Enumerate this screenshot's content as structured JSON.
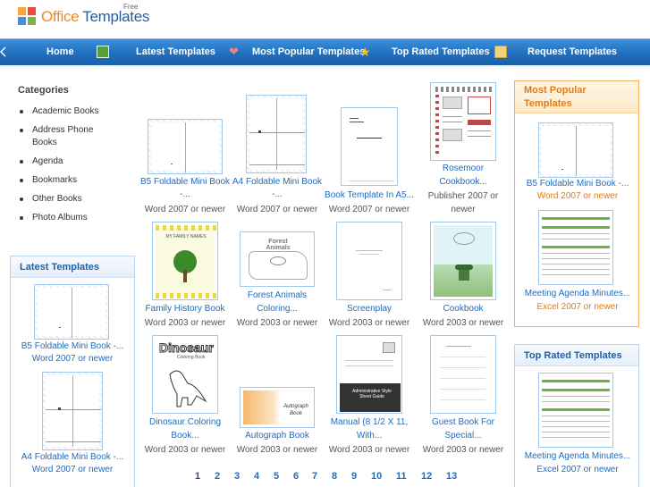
{
  "header": {
    "logo_office": "Office",
    "logo_templates": "Templates",
    "logo_free": "Free"
  },
  "nav": {
    "items": [
      "Home",
      "Latest Templates",
      "Most Popular Templates",
      "Top Rated Templates",
      "Request Templates"
    ]
  },
  "sidebar": {
    "categories_title": "Categories",
    "categories": [
      "Academic Books",
      "Address Phone Books",
      "Agenda",
      "Bookmarks",
      "Other Books",
      "Photo Albums"
    ],
    "latest_title": "Latest Templates",
    "latest": [
      {
        "title": "B5 Foldable Mini Book -...",
        "sub": "Word 2007 or newer"
      },
      {
        "title": "A4 Foldable Mini Book -...",
        "sub": "Word 2007 or newer"
      }
    ]
  },
  "main": {
    "items": [
      {
        "title": "B5 Foldable Mini Book",
        "title2": "-...",
        "sub": "Word 2007 or newer"
      },
      {
        "title": "A4 Foldable Mini Book",
        "title2": "-...",
        "sub": "Word 2007 or newer"
      },
      {
        "title": "Book Template In A5...",
        "title2": "",
        "sub": "Word 2007 or newer"
      },
      {
        "title": "Rosemoor",
        "title2": "Cookbook...",
        "sub": "Publisher 2007 or",
        "sub2": "newer"
      },
      {
        "title": "Family History Book",
        "title2": "",
        "sub": "Word 2003 or newer"
      },
      {
        "title": "Forest Animals",
        "title2": "Coloring...",
        "sub": "Word 2003 or newer"
      },
      {
        "title": "Screenplay",
        "title2": "",
        "sub": "Word 2003 or newer"
      },
      {
        "title": "Cookbook",
        "title2": "",
        "sub": "Word 2003 or newer"
      },
      {
        "title": "Dinosaur Coloring",
        "title2": "Book...",
        "sub": "Word 2003 or newer"
      },
      {
        "title": "Autograph Book",
        "title2": "",
        "sub": "Word 2003 or newer"
      },
      {
        "title": "Manual (8 1/2 X 11,",
        "title2": "With...",
        "sub": "Word 2003 or newer"
      },
      {
        "title": "Guest Book For",
        "title2": "Special...",
        "sub": "Word 2003 or newer"
      }
    ],
    "thumb_text": {
      "family": "MY FAMILY NAMES",
      "forest": "Forest Animals",
      "dino": "Dinosaur",
      "dino_sub": "Coloring Book",
      "autograph": "Autograph Book",
      "manual": "Administrative Style Sheet Guide",
      "rosemoor": "Rosemoor Cookbook"
    },
    "pages": [
      "1",
      "2",
      "3",
      "4",
      "5",
      "6",
      "7",
      "8",
      "9",
      "10",
      "11",
      "12",
      "13"
    ]
  },
  "right": {
    "popular_title": "Most Popular Templates",
    "popular": [
      {
        "title": "B5 Foldable Mini Book -...",
        "sub": "Word 2007 or newer"
      },
      {
        "title": "Meeting Agenda Minutes...",
        "sub": "Excel 2007 or newer"
      }
    ],
    "toprated_title": "Top Rated Templates",
    "toprated": [
      {
        "title": "Meeting Agenda Minutes...",
        "sub": "Excel 2007 or newer"
      }
    ]
  },
  "colors": {
    "nav_blue": "#1e6dbd",
    "link_blue": "#1e6bc0",
    "orange": "#e67a10"
  }
}
